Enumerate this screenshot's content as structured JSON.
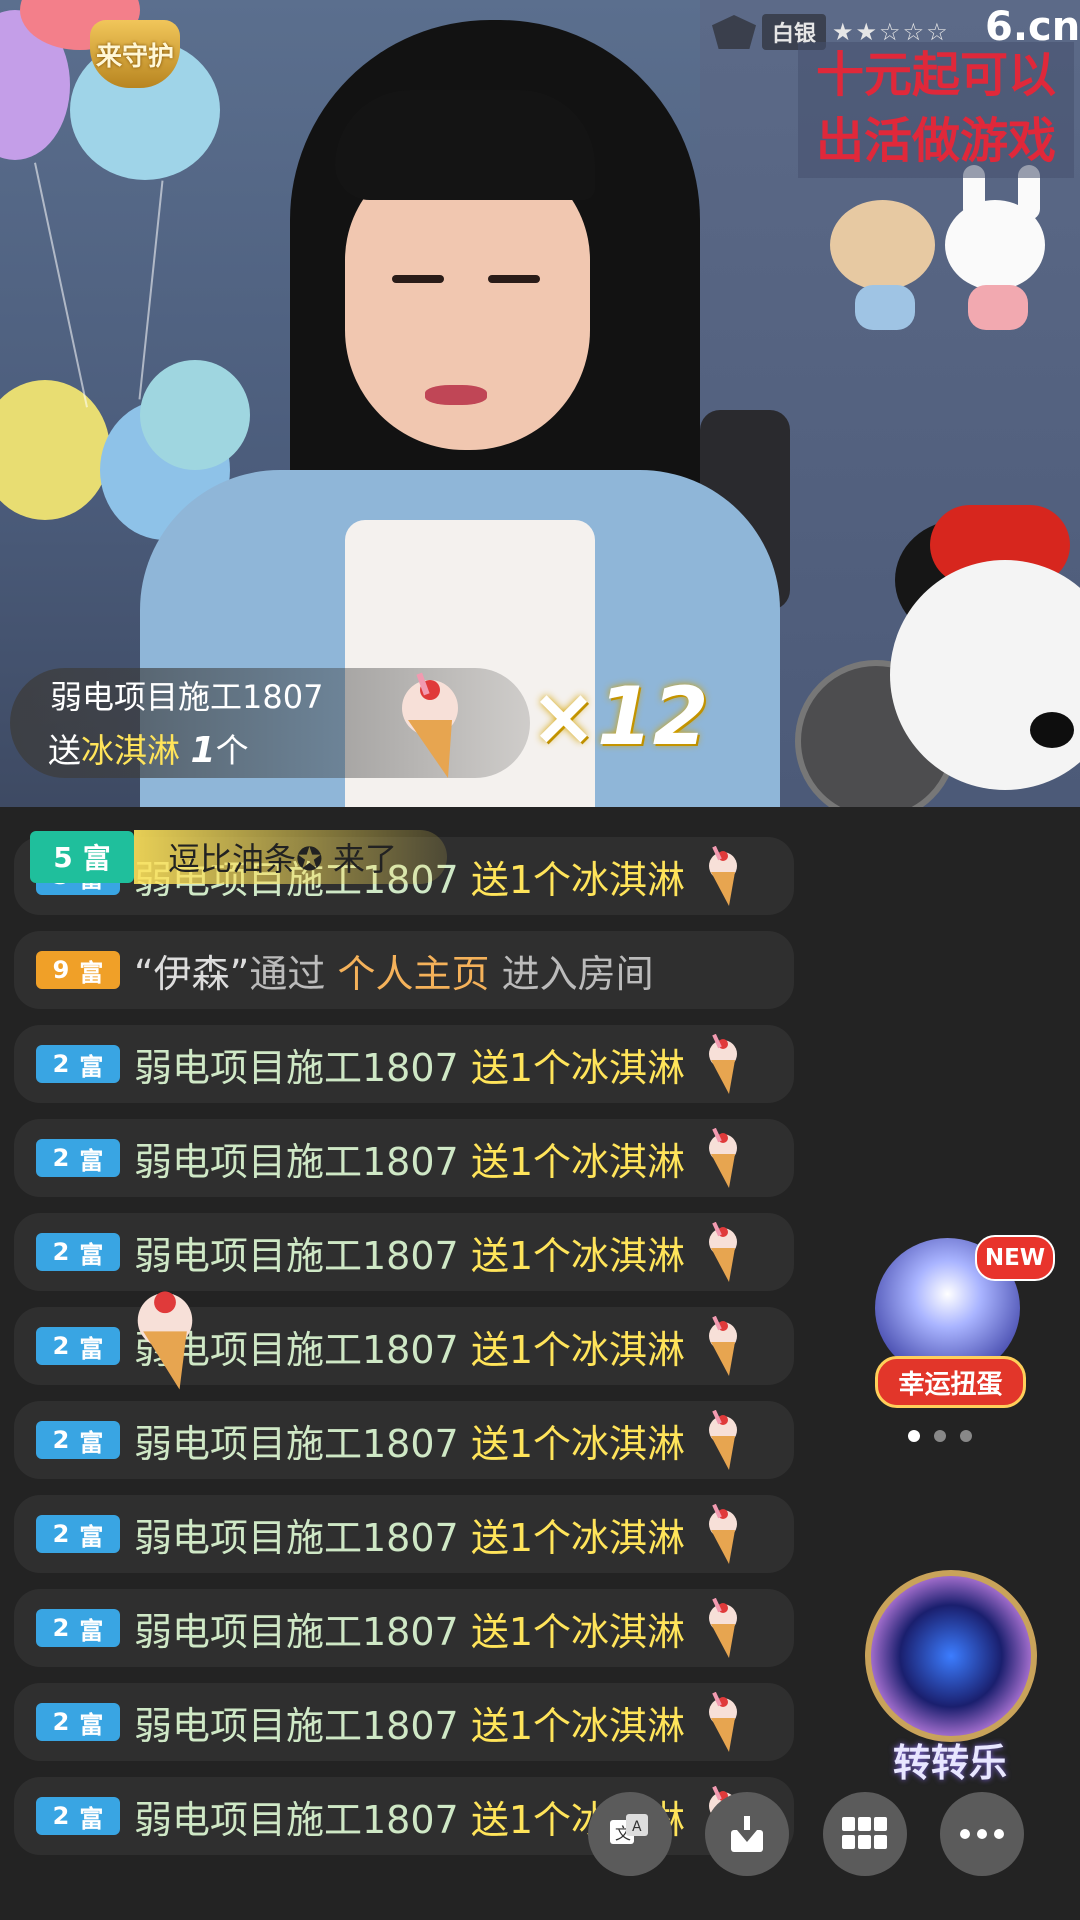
{
  "overlay": {
    "guard_label": "来守护",
    "rank_label": "白银",
    "rank_stars": "★★☆☆☆",
    "logo": "6.cn",
    "promo_line1": "十元起可以",
    "promo_line2": "出活做游戏"
  },
  "gift_banner": {
    "user": "弱电项目施工1807",
    "prefix": "送",
    "gift": "冰淇淋",
    "count": "1",
    "unit": "个",
    "multiplier": "×12"
  },
  "entry_banner": {
    "level": "5",
    "rich": "富",
    "text": "逗比油条✪ 来了"
  },
  "chat": [
    {
      "level": "5",
      "rich": "富",
      "user": "弱电项目施工1807",
      "action": "送1个冰淇淋",
      "gift_icon": "ice-cream-icon"
    },
    {
      "level": "9",
      "rich": "富",
      "quote_user": "“伊森”",
      "via": "通过",
      "link": "个人主页",
      "tail": "进入房间"
    },
    {
      "level": "2",
      "rich": "富",
      "user": "弱电项目施工1807",
      "action": "送1个冰淇淋",
      "gift_icon": "ice-cream-icon"
    },
    {
      "level": "2",
      "rich": "富",
      "user": "弱电项目施工1807",
      "action": "送1个冰淇淋",
      "gift_icon": "ice-cream-icon"
    },
    {
      "level": "2",
      "rich": "富",
      "user": "弱电项目施工1807",
      "action": "送1个冰淇淋",
      "gift_icon": "ice-cream-icon"
    },
    {
      "level": "2",
      "rich": "富",
      "user": "弱电项目施工1807",
      "action": "送1个冰淇淋",
      "gift_icon": "ice-cream-icon"
    },
    {
      "level": "2",
      "rich": "富",
      "user": "弱电项目施工1807",
      "action": "送1个冰淇淋",
      "gift_icon": "ice-cream-icon"
    },
    {
      "level": "2",
      "rich": "富",
      "user": "弱电项目施工1807",
      "action": "送1个冰淇淋",
      "gift_icon": "ice-cream-icon"
    },
    {
      "level": "2",
      "rich": "富",
      "user": "弱电项目施工1807",
      "action": "送1个冰淇淋",
      "gift_icon": "ice-cream-icon"
    },
    {
      "level": "2",
      "rich": "富",
      "user": "弱电项目施工1807",
      "action": "送1个冰淇淋",
      "gift_icon": "ice-cream-icon"
    },
    {
      "level": "2",
      "rich": "富",
      "user": "弱电项目施工1807",
      "action": "送1个冰淇淋",
      "gift_icon": "ice-cream-icon"
    }
  ],
  "side_widgets": {
    "lucky_label": "幸运扭蛋",
    "new_badge": "NEW",
    "wheel_label": "转转乐"
  },
  "toolbar": {
    "icons": [
      "translate-icon",
      "download-icon",
      "grid-icon",
      "more-icon"
    ]
  },
  "colors": {
    "gift_yellow": "#ffe45a",
    "user_green": "#cfe8c6",
    "badge_blue": "#39a5e3",
    "badge_orange": "#f0a028",
    "entry_teal": "#1fbf9c"
  }
}
